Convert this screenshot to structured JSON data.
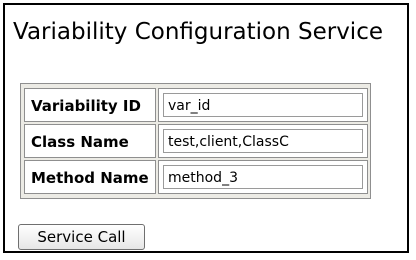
{
  "page": {
    "title": "Variability Configuration Service"
  },
  "form": {
    "fields": [
      {
        "label": "Variability ID",
        "value": "var_id"
      },
      {
        "label": "Class Name",
        "value": "test,client,ClassC"
      },
      {
        "label": "Method Name",
        "value": "method_3"
      }
    ],
    "submit_label": "Service Call"
  },
  "colors": {
    "panel_border": "#000000",
    "form_background": "#ecebe5",
    "cell_border": "#8f8f8f",
    "input_border": "#9a9a9a",
    "button_border": "#6f6f6f"
  }
}
